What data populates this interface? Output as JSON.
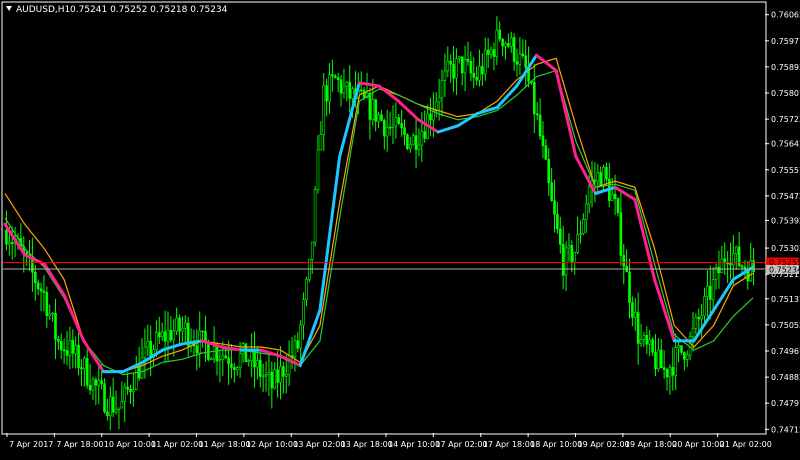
{
  "header": {
    "symbol_label": "AUDUSD,H1",
    "ohlc": "0.75241 0.75252 0.75218 0.75234"
  },
  "colors": {
    "background": "#000000",
    "frame": "#ffffff",
    "text": "#ffffff",
    "candles": "#00ff00",
    "ma_fast_up": "#1ec8ff",
    "ma_fast_down": "#ff1f8f",
    "ma_slow_1": "#ffa500",
    "ma_slow_2": "#2ecc2e",
    "price_line_bid": "#b0b0b0",
    "price_line_ask": "#ff0000",
    "price_tag_bid": "#c0c0c0",
    "price_tag_ask": "#ff0000"
  },
  "chart_data": {
    "type": "line",
    "title": "AUDUSD,H1",
    "xlabel": "",
    "ylabel": "",
    "ylim": [
      0.747,
      0.761
    ],
    "grid": false,
    "y_ticks": [
      "0.76062",
      "0.75977",
      "0.75892",
      "0.75807",
      "0.75722",
      "0.75642",
      "0.75557",
      "0.75472",
      "0.75392",
      "0.75302",
      "0.75217",
      "0.75137",
      "0.75052",
      "0.74967",
      "0.74882",
      "0.74797",
      "0.74712"
    ],
    "x_ticks": [
      "7 Apr 2017",
      "7 Apr 18:00",
      "10 Apr 10:00",
      "11 Apr 02:00",
      "11 Apr 18:00",
      "12 Apr 10:00",
      "13 Apr 02:00",
      "13 Apr 18:00",
      "14 Apr 10:00",
      "17 Apr 02:00",
      "17 Apr 18:00",
      "18 Apr 10:00",
      "19 Apr 02:00",
      "19 Apr 18:00",
      "20 Apr 10:00",
      "21 Apr 02:00"
    ],
    "price_tags": {
      "ask": "0.75255",
      "bid": "0.75234"
    },
    "x": [
      0,
      2,
      4,
      6,
      8,
      10,
      12,
      14,
      16,
      18,
      20,
      22,
      24,
      26,
      28,
      30,
      32,
      34,
      36,
      38,
      40,
      42,
      44,
      46,
      48,
      50,
      52,
      54,
      56,
      58,
      60,
      62,
      64,
      66,
      68,
      70,
      72,
      74,
      76,
      78,
      80,
      82,
      84,
      86,
      88,
      90,
      92,
      94,
      96,
      98,
      100,
      102,
      104,
      106,
      108,
      110,
      112,
      114,
      116,
      118,
      120,
      122,
      124,
      126,
      128,
      130,
      132,
      134,
      136,
      138,
      140,
      142,
      144,
      146,
      148,
      150
    ],
    "series": [
      {
        "type": "candles",
        "close": [
          0.7536,
          0.753,
          0.7522,
          0.7515,
          0.75,
          0.7497,
          0.7492,
          0.7485,
          0.748,
          0.7478,
          0.7488,
          0.7495,
          0.75,
          0.7503,
          0.7504,
          0.75,
          0.7498,
          0.7496,
          0.7494,
          0.7495,
          0.749,
          0.7485,
          0.7492,
          0.7498,
          0.7525,
          0.758,
          0.7585,
          0.758,
          0.7578,
          0.7575,
          0.757,
          0.7568,
          0.7565,
          0.757,
          0.758,
          0.7588,
          0.759,
          0.7585,
          0.7592,
          0.76,
          0.7595,
          0.7588,
          0.757,
          0.7545,
          0.7525,
          0.753,
          0.755,
          0.7555,
          0.7545,
          0.752,
          0.75,
          0.7495,
          0.749,
          0.7495,
          0.75,
          0.751,
          0.752,
          0.753,
          0.7525,
          0.7523
        ]
      },
      {
        "type": "ma",
        "period_role": "fast",
        "values": [
          0.7538,
          0.7528,
          0.7525,
          0.7515,
          0.75,
          0.749,
          0.749,
          0.7493,
          0.7497,
          0.7499,
          0.75,
          0.7498,
          0.7497,
          0.7497,
          0.7495,
          0.7492,
          0.751,
          0.756,
          0.7584,
          0.7583,
          0.7578,
          0.7572,
          0.7568,
          0.757,
          0.7574,
          0.7576,
          0.7583,
          0.7593,
          0.7588,
          0.756,
          0.7548,
          0.755,
          0.7546,
          0.752,
          0.75,
          0.75,
          0.751,
          0.752,
          0.7524
        ]
      },
      {
        "type": "ma",
        "period_role": "slow1",
        "values": [
          0.7548,
          0.7538,
          0.753,
          0.752,
          0.75,
          0.749,
          0.749,
          0.7492,
          0.7495,
          0.7497,
          0.75,
          0.7499,
          0.7498,
          0.7498,
          0.7497,
          0.7493,
          0.7505,
          0.7545,
          0.758,
          0.7583,
          0.758,
          0.7577,
          0.7575,
          0.7573,
          0.7574,
          0.7578,
          0.7585,
          0.759,
          0.7592,
          0.757,
          0.755,
          0.7552,
          0.755,
          0.753,
          0.7505,
          0.7498,
          0.7505,
          0.7518,
          0.7522
        ]
      },
      {
        "type": "ma",
        "period_role": "slow2",
        "values": [
          0.754,
          0.753,
          0.7524,
          0.7514,
          0.75,
          0.7492,
          0.7489,
          0.749,
          0.7493,
          0.7494,
          0.7496,
          0.7497,
          0.7497,
          0.7496,
          0.7495,
          0.7492,
          0.75,
          0.754,
          0.7578,
          0.7582,
          0.758,
          0.7577,
          0.7574,
          0.7572,
          0.7573,
          0.7575,
          0.758,
          0.7586,
          0.7588,
          0.7565,
          0.755,
          0.7551,
          0.7549,
          0.7525,
          0.7502,
          0.7497,
          0.75,
          0.7508,
          0.7514
        ]
      }
    ]
  }
}
